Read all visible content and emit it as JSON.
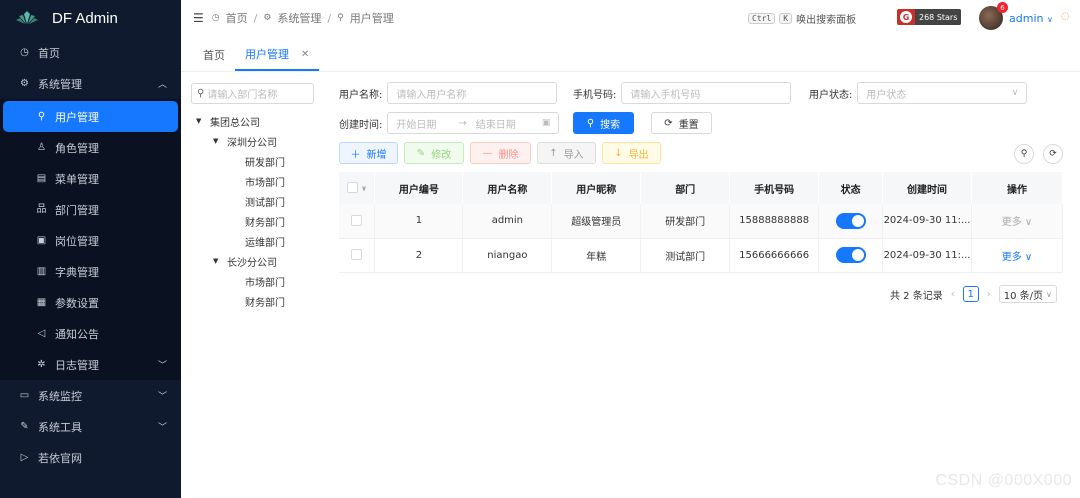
{
  "app": {
    "title": "DF Admin"
  },
  "sidebar": {
    "items": [
      {
        "label": "首页",
        "icon": "dashboard-icon"
      },
      {
        "label": "系统管理",
        "icon": "gear-icon",
        "expanded": true
      },
      {
        "label": "用户管理",
        "icon": "user-icon",
        "active": true
      },
      {
        "label": "角色管理",
        "icon": "role-icon"
      },
      {
        "label": "菜单管理",
        "icon": "menu-icon"
      },
      {
        "label": "部门管理",
        "icon": "tree-icon"
      },
      {
        "label": "岗位管理",
        "icon": "post-icon"
      },
      {
        "label": "字典管理",
        "icon": "dict-icon"
      },
      {
        "label": "参数设置",
        "icon": "params-icon"
      },
      {
        "label": "通知公告",
        "icon": "notice-icon"
      },
      {
        "label": "日志管理",
        "icon": "log-icon"
      },
      {
        "label": "系统监控",
        "icon": "monitor-icon"
      },
      {
        "label": "系统工具",
        "icon": "tool-icon"
      },
      {
        "label": "若依官网",
        "icon": "send-icon"
      }
    ]
  },
  "header": {
    "breadcrumbs": [
      "首页",
      "系统管理",
      "用户管理"
    ],
    "search_key1": "Ctrl",
    "search_key2": "K",
    "search_hint": "唤出搜索面板",
    "stars": "268 Stars",
    "badge": "6",
    "user": "admin"
  },
  "tabs": [
    "首页",
    "用户管理"
  ],
  "tree": {
    "search_placeholder": "请输入部门名称",
    "nodes": [
      {
        "label": "集团总公司",
        "level": 0,
        "arrow": true
      },
      {
        "label": "深圳分公司",
        "level": 1,
        "arrow": true
      },
      {
        "label": "研发部门",
        "level": 2
      },
      {
        "label": "市场部门",
        "level": 2
      },
      {
        "label": "测试部门",
        "level": 2
      },
      {
        "label": "财务部门",
        "level": 2
      },
      {
        "label": "运维部门",
        "level": 2
      },
      {
        "label": "长沙分公司",
        "level": 1,
        "arrow": true
      },
      {
        "label": "市场部门",
        "level": 2
      },
      {
        "label": "财务部门",
        "level": 2
      }
    ]
  },
  "form": {
    "username_label": "用户名称:",
    "username_placeholder": "请输入用户名称",
    "phone_label": "手机号码:",
    "phone_placeholder": "请输入手机号码",
    "status_label": "用户状态:",
    "status_placeholder": "用户状态",
    "created_label": "创建时间:",
    "start_placeholder": "开始日期",
    "end_placeholder": "结束日期",
    "search_btn": "搜索",
    "reset_btn": "重置"
  },
  "toolbar": {
    "add": "新增",
    "edit": "修改",
    "delete": "删除",
    "import": "导入",
    "export": "导出"
  },
  "table": {
    "headers": [
      "用户编号",
      "用户名称",
      "用户昵称",
      "部门",
      "手机号码",
      "状态",
      "创建时间",
      "操作"
    ],
    "rows": [
      {
        "id": "1",
        "username": "admin",
        "nickname": "超级管理员",
        "dept": "研发部门",
        "phone": "15888888888",
        "status": true,
        "created": "2024-09-30 11:...",
        "action": "更多",
        "action_disabled": true
      },
      {
        "id": "2",
        "username": "niangao",
        "nickname": "年糕",
        "dept": "测试部门",
        "phone": "15666666666",
        "status": true,
        "created": "2024-09-30 11:...",
        "action": "更多",
        "action_disabled": false
      }
    ]
  },
  "pagination": {
    "total_text": "共 2 条记录",
    "current": "1",
    "page_size": "10 条/页"
  },
  "watermark": "CSDN @000X000",
  "colors": {
    "sidebar_bg": "#0f1a2e",
    "accent": "#1677ff"
  }
}
